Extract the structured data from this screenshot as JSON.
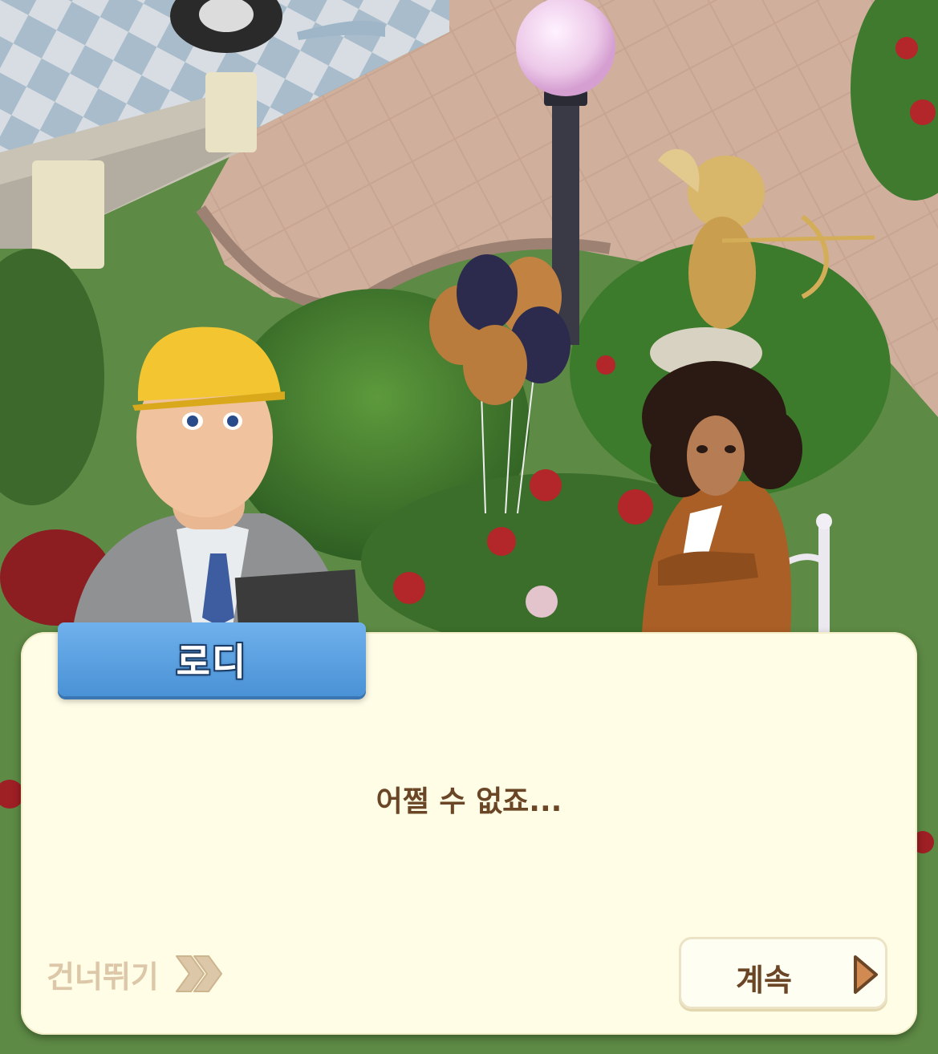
{
  "dialog": {
    "speaker_name": "로디",
    "text": "어쩔 수 없죠...",
    "skip_label": "건너뛰기",
    "continue_label": "계속"
  },
  "scene": {
    "characters": [
      "construction-worker-character",
      "curly-haired-woman-character"
    ],
    "props": [
      "lamp-post",
      "cupid-statue",
      "balloons",
      "rose-bushes",
      "hedge-bush",
      "stone-wall",
      "checkered-floor",
      "paved-path",
      "garden-fence"
    ]
  },
  "colors": {
    "panel_bg": "#fffde6",
    "tab_blue": "#4a92d6",
    "text_brown": "#6b4626",
    "skip_beige": "#dcc7a8",
    "arrow_orange": "#d08a52"
  }
}
